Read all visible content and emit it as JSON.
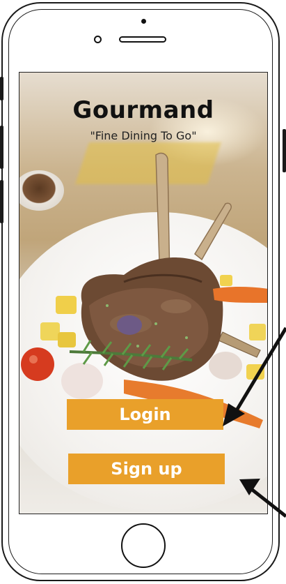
{
  "app": {
    "title": "Gourmand",
    "tagline": "\"Fine Dining To Go\""
  },
  "buttons": {
    "login": "Login",
    "signup": "Sign up"
  },
  "colors": {
    "button": "#e9a02a",
    "button_text": "#ffffff",
    "title": "#111111"
  },
  "annotations": {
    "arrows": [
      "arrow-pointing-to-login",
      "arrow-pointing-to-signup"
    ]
  }
}
